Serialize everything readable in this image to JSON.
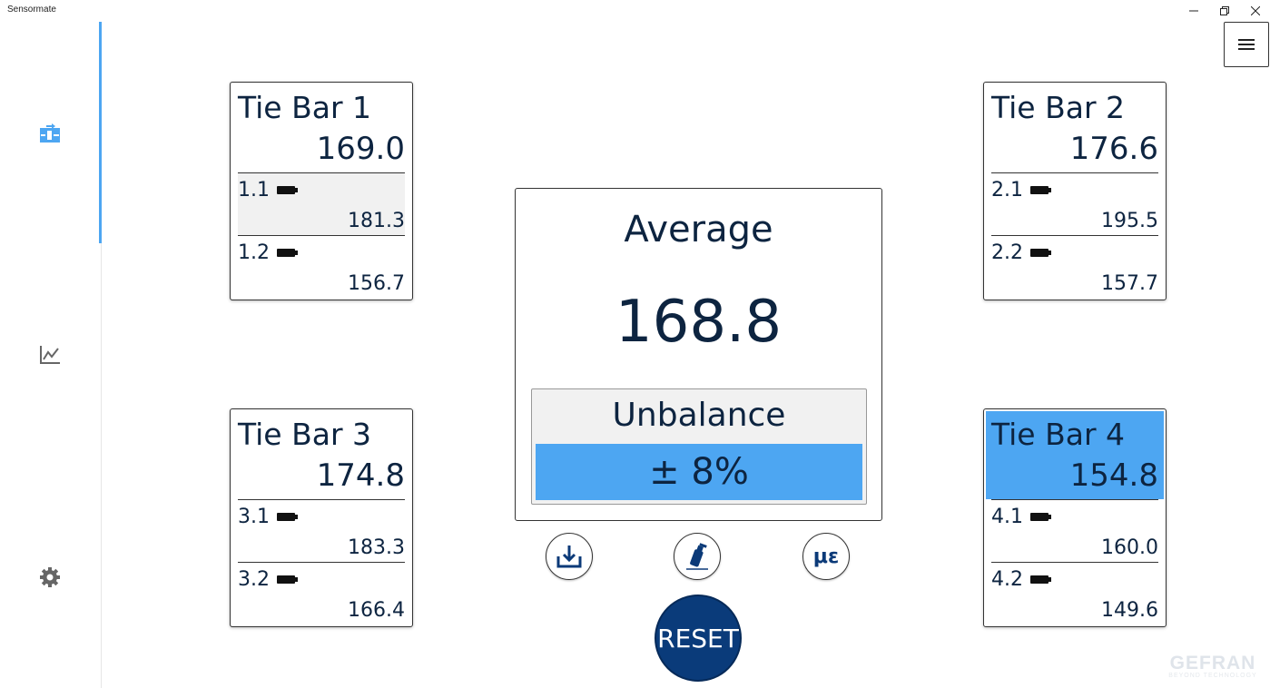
{
  "window": {
    "title": "Sensormate",
    "min_icon": "minimize-icon",
    "max_icon": "restore-icon",
    "close_icon": "close-icon"
  },
  "sidebar": {
    "items": [
      {
        "icon": "transfer-icon",
        "active": true
      },
      {
        "icon": "line-chart-icon",
        "active": false
      },
      {
        "icon": "gear-icon",
        "active": false
      }
    ],
    "accent": "#4da6f2"
  },
  "menu": {
    "icon": "hamburger-icon"
  },
  "tie_bars": [
    {
      "title": "Tie Bar 1",
      "value": "169.0",
      "active": false,
      "sensors": [
        {
          "id": "1.1",
          "value": "181.3",
          "highlight": true
        },
        {
          "id": "1.2",
          "value": "156.7",
          "highlight": false
        }
      ]
    },
    {
      "title": "Tie Bar 2",
      "value": "176.6",
      "active": false,
      "sensors": [
        {
          "id": "2.1",
          "value": "195.5",
          "highlight": false
        },
        {
          "id": "2.2",
          "value": "157.7",
          "highlight": false
        }
      ]
    },
    {
      "title": "Tie Bar 3",
      "value": "174.8",
      "active": false,
      "sensors": [
        {
          "id": "3.1",
          "value": "183.3",
          "highlight": false
        },
        {
          "id": "3.2",
          "value": "166.4",
          "highlight": false
        }
      ]
    },
    {
      "title": "Tie Bar 4",
      "value": "154.8",
      "active": true,
      "sensors": [
        {
          "id": "4.1",
          "value": "160.0",
          "highlight": false
        },
        {
          "id": "4.2",
          "value": "149.6",
          "highlight": false
        }
      ]
    }
  ],
  "average": {
    "label": "Average",
    "value": "168.8"
  },
  "unbalance": {
    "label": "Unbalance",
    "value": "± 8%",
    "color": "#4da6f2"
  },
  "actions": {
    "download_icon": "download-icon",
    "calibrate_icon": "spray-bottle-icon",
    "unit_label": "με",
    "reset_label": "RESET",
    "reset_color": "#0a3b7a"
  },
  "brand": {
    "logo": "GEFRAN",
    "tagline": "BEYOND TECHNOLOGY"
  }
}
